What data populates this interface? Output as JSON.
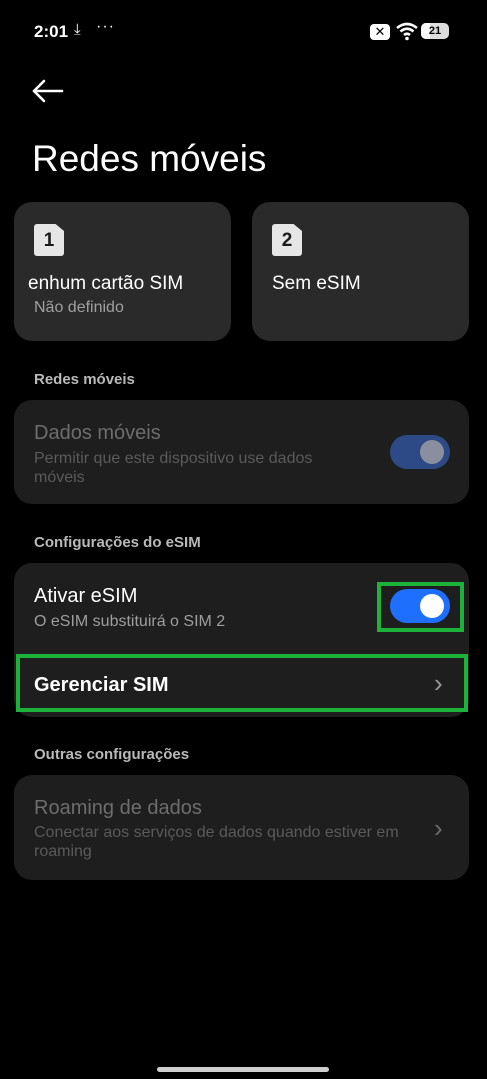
{
  "status_bar": {
    "time": "2:01",
    "download_icon": "download-icon",
    "more_dots": "···",
    "battery_level": "21"
  },
  "header": {
    "title": "Redes móveis"
  },
  "sim_cards": [
    {
      "number": "1",
      "name": "enhum cartão SIM",
      "status": "Não definido"
    },
    {
      "number": "2",
      "name": "Sem eSIM",
      "status": ""
    }
  ],
  "sections": {
    "mobile_networks": "Redes móveis",
    "esim_settings": "Configurações do eSIM",
    "other_settings": "Outras configurações"
  },
  "mobile_data": {
    "title": "Dados móveis",
    "subtitle": "Permitir que este dispositivo use dados móveis",
    "enabled": true,
    "disabled_look": true
  },
  "activate_esim": {
    "title": "Ativar eSIM",
    "subtitle": "O eSIM substituirá o SIM 2",
    "enabled": true
  },
  "manage_sim": {
    "title": "Gerenciar SIM"
  },
  "data_roaming": {
    "title": "Roaming de dados",
    "subtitle": "Conectar aos serviços de dados quando estiver em roaming"
  },
  "colors": {
    "background": "#000000",
    "card": "#1e1e1e",
    "accent": "#1f6fff",
    "highlight": "#1db33a"
  }
}
